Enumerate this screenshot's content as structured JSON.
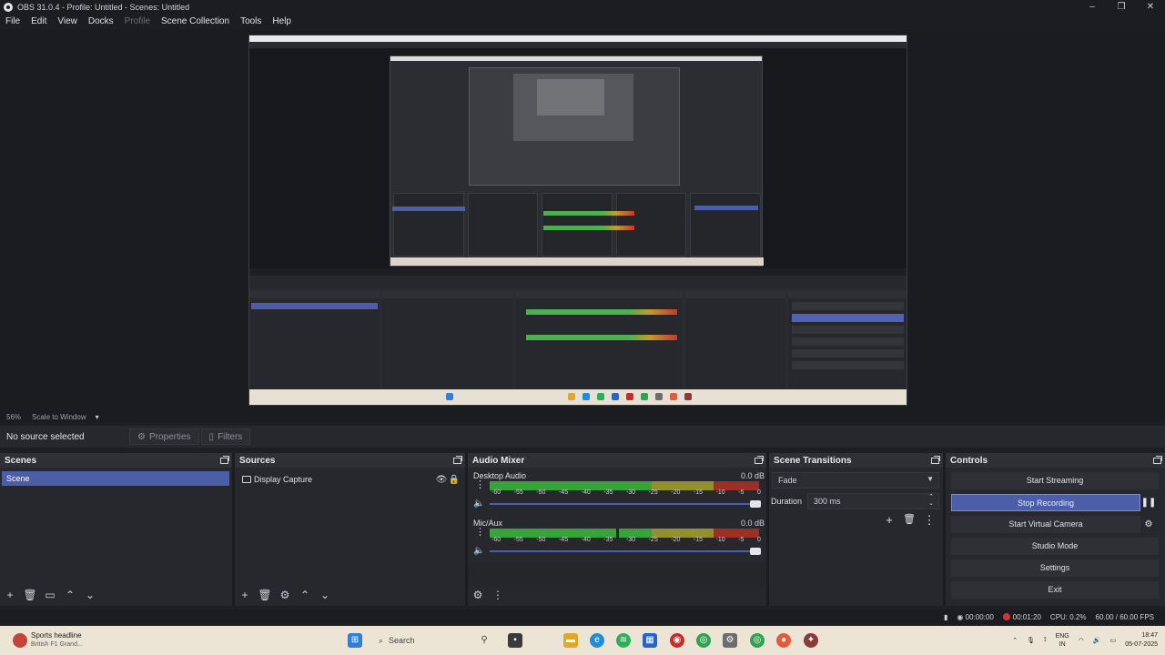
{
  "window": {
    "title": "OBS 31.0.4 - Profile: Untitled - Scenes: Untitled",
    "controls": [
      "–",
      "❐",
      "✕"
    ]
  },
  "menu": {
    "items": [
      {
        "label": "File",
        "enabled": true
      },
      {
        "label": "Edit",
        "enabled": true
      },
      {
        "label": "View",
        "enabled": true
      },
      {
        "label": "Docks",
        "enabled": true
      },
      {
        "label": "Profile",
        "enabled": false
      },
      {
        "label": "Scene Collection",
        "enabled": true
      },
      {
        "label": "Tools",
        "enabled": true
      },
      {
        "label": "Help",
        "enabled": true
      }
    ]
  },
  "preview_status": {
    "zoom": "56%",
    "scale_mode": "Scale to Window",
    "caret": "▾"
  },
  "properties_bar": {
    "no_source": "No source selected",
    "properties_label": "Properties",
    "filters_label": "Filters"
  },
  "scenes": {
    "header": "Scenes",
    "items": [
      "Scene"
    ],
    "toolbar": [
      "+",
      "🗑",
      "▭",
      "⌃",
      "⌄"
    ]
  },
  "sources": {
    "header": "Sources",
    "items": [
      {
        "label": "Display Capture",
        "visible_icon": "👁",
        "lock_icon": "🔒"
      }
    ],
    "toolbar": [
      "+",
      "🗑",
      "⚙",
      "⌃",
      "⌄"
    ]
  },
  "audio_mixer": {
    "header": "Audio Mixer",
    "channels": [
      {
        "name": "Desktop Audio",
        "db": "0.0 dB",
        "level": 0.86
      },
      {
        "name": "Mic/Aux",
        "db": "0.0 dB",
        "level": 0.86
      }
    ],
    "ticks": [
      "-60",
      "-55",
      "-50",
      "-45",
      "-40",
      "-35",
      "-30",
      "-25",
      "-20",
      "-15",
      "-10",
      "-5",
      "0"
    ],
    "toolbar": [
      "⚙",
      "⋮"
    ]
  },
  "transitions": {
    "header": "Scene Transitions",
    "selected": "Fade",
    "duration_label": "Duration",
    "duration_value": "300 ms",
    "toolbar": [
      "+",
      "🗑",
      "⋮"
    ]
  },
  "controls": {
    "header": "Controls",
    "start_streaming": "Start Streaming",
    "stop_recording": "Stop Recording",
    "pause_icon": "❚❚",
    "start_virtual_camera": "Start Virtual Camera",
    "gear_icon": "⚙",
    "studio_mode": "Studio Mode",
    "settings": "Settings",
    "exit": "Exit"
  },
  "app_status": {
    "stream_time": "00:00:00",
    "rec_time": "00:01:20",
    "cpu": "CPU: 0.2%",
    "fps": "60.00 / 60.00 FPS"
  },
  "taskbar": {
    "news_title": "Sports headline",
    "news_sub": "British F1 Grand...",
    "search_placeholder": "Search",
    "lang_top": "ENG",
    "lang_bottom": "IN",
    "time": "18:47",
    "date": "05-07-2025"
  },
  "colors": {
    "accent": "#4c5ea8",
    "recording": "#d9323b",
    "meter_green": "#38a23b",
    "meter_yellow": "#93902e",
    "meter_red": "#9c2f26"
  }
}
